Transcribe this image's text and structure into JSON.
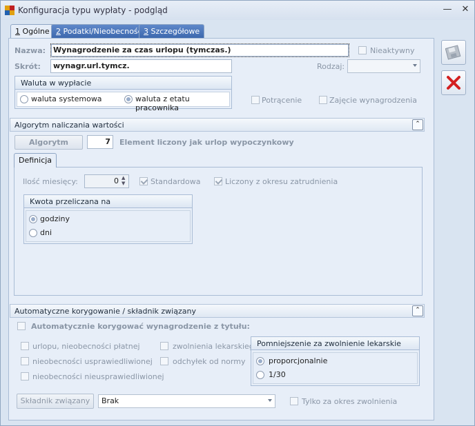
{
  "window": {
    "title": "Konfiguracja typu wypłaty - podgląd",
    "minimize": "—",
    "close": "✕"
  },
  "tabs": [
    {
      "num": "1",
      "label": "Ogólne",
      "active": true
    },
    {
      "num": "2",
      "label": "Podatki/Nieobecności",
      "active": false
    },
    {
      "num": "3",
      "label": "Szczegółowe",
      "active": false
    }
  ],
  "general": {
    "nazwa_label": "Nazwa:",
    "nazwa_value": "Wynagrodzenie za czas urlopu (tymczas.)",
    "skrot_label": "Skrót:",
    "skrot_value": "wynagr.url.tymcz.",
    "nieaktywny_label": "Nieaktywny",
    "rodzaj_label": "Rodzaj:",
    "rodzaj_value": "",
    "waluta_title": "Waluta w wypłacie",
    "waluta_systemowa": "waluta systemowa",
    "waluta_etatu": "waluta z etatu pracownika",
    "potracenie": "Potrącenie",
    "zajecie": "Zajęcie wynagrodzenia"
  },
  "algorytm": {
    "section_title": "Algorytm naliczania wartości",
    "button_label": "Algorytm",
    "number": "7",
    "description": "Element liczony jak urlop wypoczynkowy",
    "subtab": "Definicja",
    "ilosc_label": "Ilość miesięcy:",
    "ilosc_value": "0",
    "standardowa": "Standardowa",
    "liczony": "Liczony z okresu zatrudnienia",
    "kwota_title": "Kwota przeliczana na",
    "godziny": "godziny",
    "dni": "dni"
  },
  "korekta": {
    "section_title": "Automatyczne korygowanie / składnik związany",
    "auto_label": "Automatycznie korygować wynagrodzenie z tytułu:",
    "urlopu": "urlopu, nieobecności płatnej",
    "usprawiedliwionej": "nieobecności usprawiedliwionej",
    "nieusprawiedliwionej": "nieobecności nieusprawiedliwionej",
    "zwolnienia": "zwolnienia lekarskiego",
    "odchylek": "odchyłek od normy",
    "pomniejszenie_title": "Pomniejszenie za zwolnienie lekarskie",
    "proporcjonalnie": "proporcjonalnie",
    "ulamek": "1/30",
    "skladnik_button": "Składnik związany",
    "skladnik_value": "Brak",
    "tylko_label": "Tylko za okres zwolnienia"
  },
  "colors": {
    "accent_tab": "#3b67ad",
    "cancel_red": "#d32020",
    "panel_bg": "#e7eef8"
  },
  "icons": {
    "save": "save-disk-icon",
    "cancel": "red-x-icon"
  }
}
